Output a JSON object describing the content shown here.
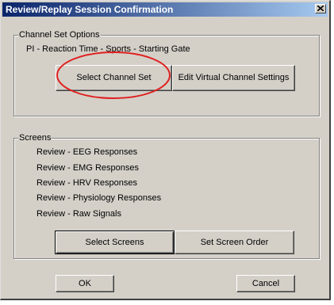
{
  "window": {
    "title": "Review/Replay Session Confirmation",
    "close_icon": "close-icon"
  },
  "channel_set": {
    "group_label": "Channel Set Options",
    "current_value": "PI - Reaction Time - Sports - Starting Gate",
    "select_button": "Select Channel Set",
    "edit_button": "Edit Virtual Channel Settings"
  },
  "screens": {
    "group_label": "Screens",
    "items": [
      "Review - EEG Responses",
      "Review - EMG Responses",
      "Review - HRV Responses",
      "Review - Physiology Responses",
      "Review - Raw Signals"
    ],
    "select_button": "Select Screens",
    "order_button": "Set Screen Order"
  },
  "footer": {
    "ok_button": "OK",
    "cancel_button": "Cancel"
  },
  "colors": {
    "title_bar_start": "#0a246a",
    "title_bar_end": "#a6caf0",
    "dialog_face": "#d4d0c8",
    "annotation_circle": "#e02020"
  }
}
